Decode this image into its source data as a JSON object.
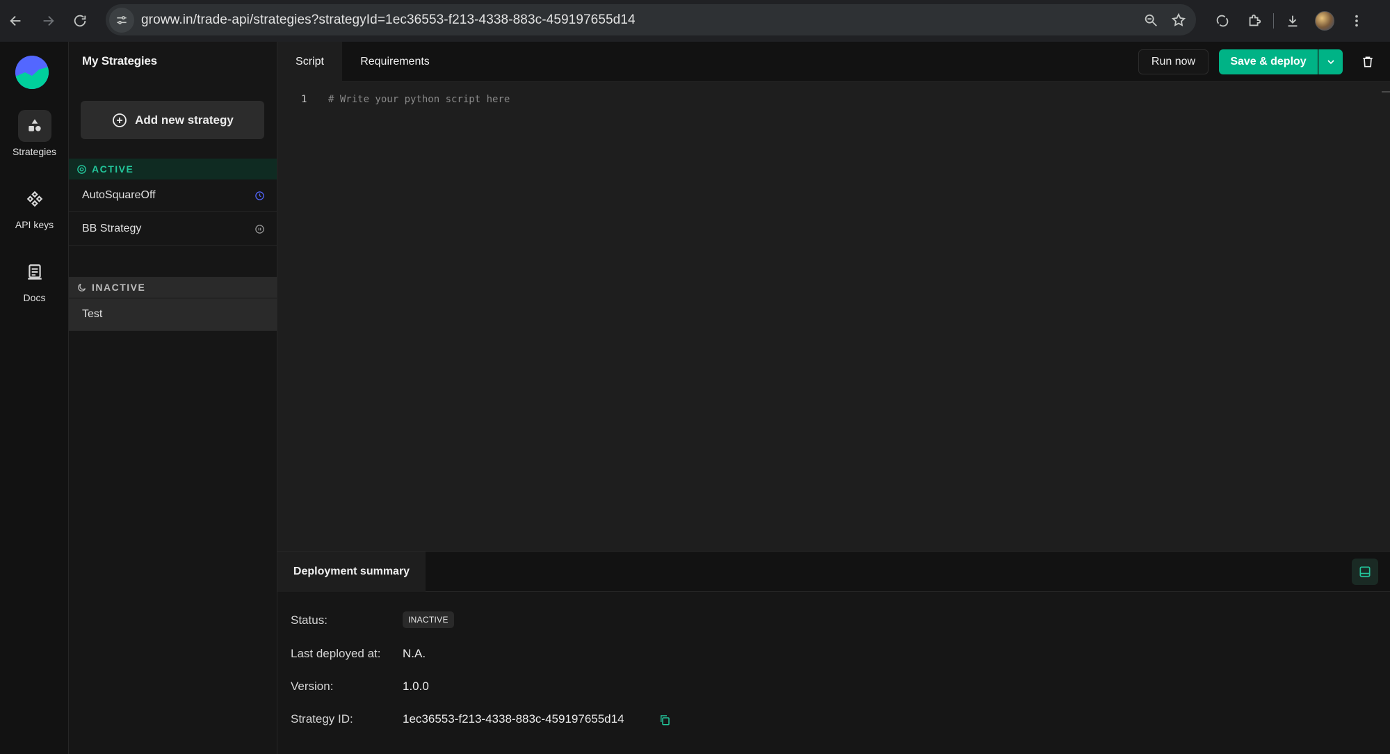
{
  "browser": {
    "url": "groww.in/trade-api/strategies?strategyId=1ec36553-f213-4338-883c-459197655d14"
  },
  "rail": {
    "items": [
      {
        "label": "Strategies",
        "icon": "shapes-icon"
      },
      {
        "label": "API keys",
        "icon": "api-nodes-icon"
      },
      {
        "label": "Docs",
        "icon": "document-icon"
      }
    ]
  },
  "sidebar": {
    "title": "My Strategies",
    "add_button": "Add new strategy",
    "active_label": "ACTIVE",
    "active_items": [
      {
        "name": "AutoSquareOff",
        "status_icon": "clock-icon"
      },
      {
        "name": "BB Strategy",
        "status_icon": "pause-icon"
      }
    ],
    "inactive_label": "INACTIVE",
    "inactive_items": [
      {
        "name": "Test"
      }
    ]
  },
  "toolbar": {
    "tabs": [
      "Script",
      "Requirements"
    ],
    "run_label": "Run now",
    "deploy_label": "Save & deploy"
  },
  "editor": {
    "line_number": "1",
    "code": "# Write your python script here"
  },
  "summary": {
    "tab_label": "Deployment summary",
    "status_label": "Status:",
    "status_value": "INACTIVE",
    "deployed_label": "Last deployed at:",
    "deployed_value": "N.A.",
    "version_label": "Version:",
    "version_value": "1.0.0",
    "id_label": "Strategy ID:",
    "id_value": "1ec36553-f213-4338-883c-459197655d14"
  },
  "colors": {
    "accent": "#00b386",
    "active_text": "#23c69b",
    "clock_icon": "#5367ff"
  }
}
